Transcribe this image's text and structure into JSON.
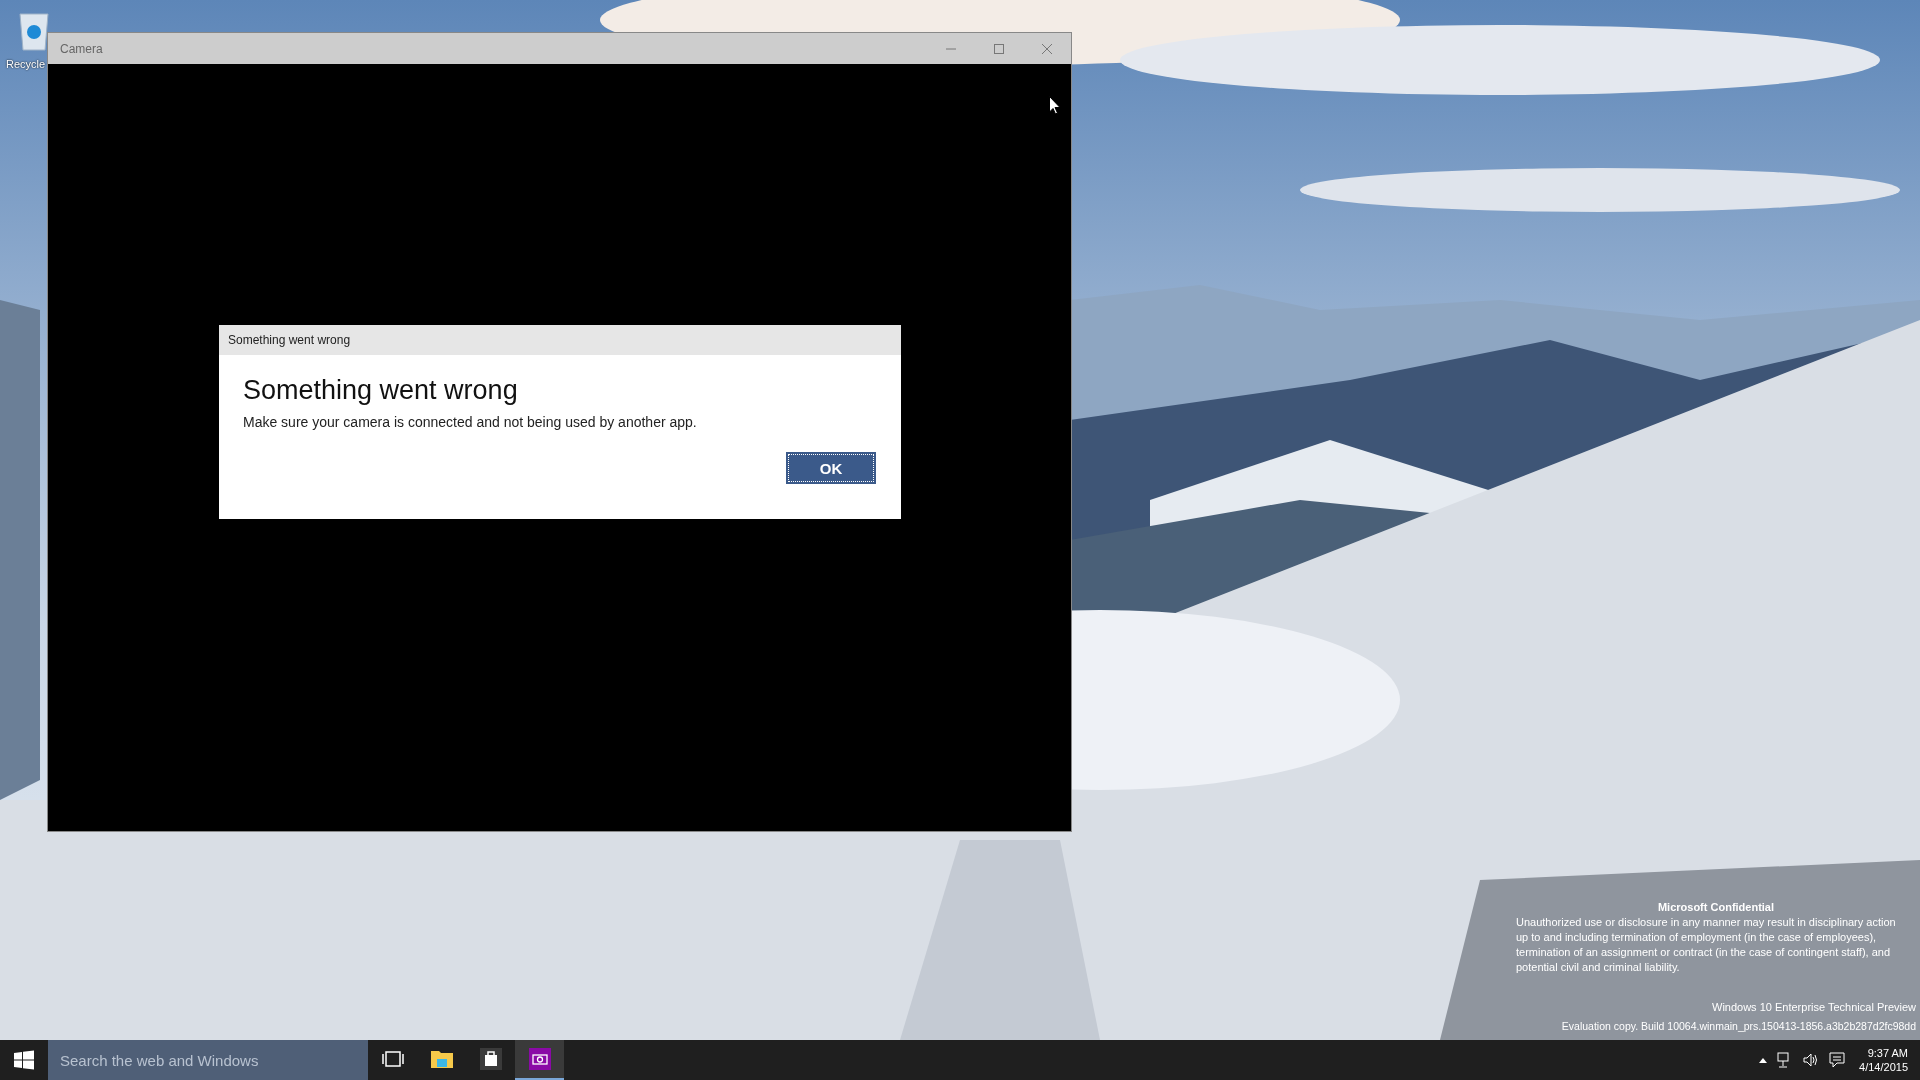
{
  "desktop": {
    "icons": [
      {
        "label": "Recycle"
      }
    ]
  },
  "window": {
    "title": "Camera",
    "dialog": {
      "title": "Something went wrong",
      "heading": "Something went wrong",
      "message": "Make sure your camera is connected and not being used by another app.",
      "buttons": [
        {
          "label": "OK",
          "focused": true
        }
      ]
    }
  },
  "desktop_notice": {
    "title": "Microsoft Confidential",
    "body": "Unauthorized use or disclosure in any manner may result in disciplinary action up to and including termination of employment (in the case of employees), termination of an assignment or contract (in the case of contingent staff), and potential civil and criminal liability.",
    "edition": "Windows 10 Enterprise Technical Preview",
    "build": "Evaluation copy. Build 10064.winmain_prs.150413-1856.a3b2b287d2fc98dd"
  },
  "taskbar": {
    "search": {
      "placeholder": "Search the web and Windows"
    },
    "apps": [
      {
        "kind": "task-view",
        "selected": false
      },
      {
        "kind": "file-explorer",
        "selected": false
      },
      {
        "kind": "store",
        "selected": false
      },
      {
        "kind": "camera",
        "selected": true
      }
    ],
    "clock": {
      "time": "9:37 AM",
      "date": "4/14/2015"
    }
  }
}
